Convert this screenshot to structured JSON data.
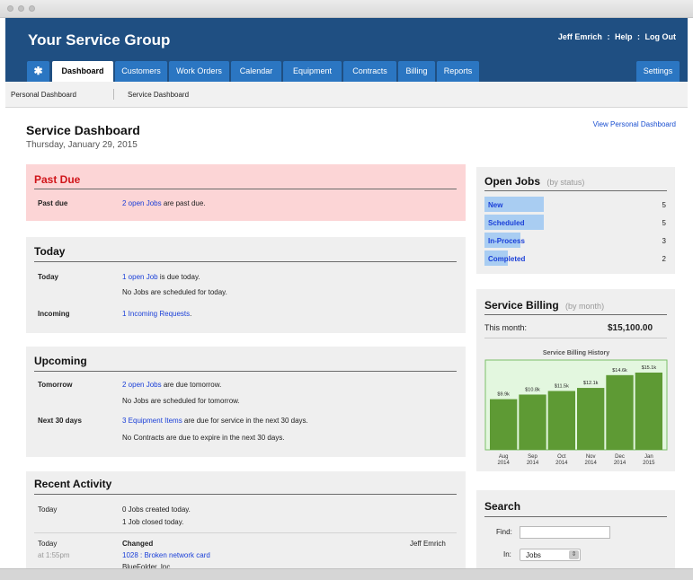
{
  "header": {
    "app_title": "Your Service Group",
    "user_name": "Jeff Emrich",
    "help": "Help",
    "logout": "Log Out",
    "separator": ":"
  },
  "nav": {
    "home_icon": "asterisk-icon",
    "tabs": [
      "Dashboard",
      "Customers",
      "Work Orders",
      "Calendar",
      "Equipment",
      "Contracts",
      "Billing",
      "Reports"
    ],
    "settings": "Settings",
    "active_tab": "Dashboard"
  },
  "subnav": [
    "Personal Dashboard",
    "Service Dashboard"
  ],
  "page": {
    "title": "Service Dashboard",
    "date": "Thursday, January 29, 2015",
    "view_personal": "View Personal Dashboard"
  },
  "past_due": {
    "title": "Past Due",
    "label": "Past due",
    "link": "2 open Jobs",
    "text": " are past due."
  },
  "today": {
    "title": "Today",
    "label_today": "Today",
    "line1_link": "1 open Job",
    "line1_text": " is due today.",
    "line2": "No Jobs are scheduled for today.",
    "label_incoming": "Incoming",
    "incoming_link": "1 Incoming Requests",
    "incoming_text": "."
  },
  "upcoming": {
    "title": "Upcoming",
    "label_tomorrow": "Tomorrow",
    "line1_link": "2 open Jobs",
    "line1_text": " are due tomorrow.",
    "line2": "No Jobs are scheduled for tomorrow.",
    "label_next30": "Next 30 days",
    "line3_link": "3 Equipment Items",
    "line3_text": " are due for service in the next 30 days.",
    "line4": "No Contracts are due to expire in the next 30 days."
  },
  "recent": {
    "title": "Recent Activity",
    "row1_label": "Today",
    "row1_line1": "0 Jobs created today.",
    "row1_line2": "1 Job closed today.",
    "row2_label": "Today",
    "row2_time": "at 1:55pm",
    "row2_action": "Changed",
    "row2_link": "1028 : Broken network card",
    "row2_company": "BlueFolder, Inc.",
    "row2_user": "Jeff Emrich"
  },
  "open_jobs": {
    "title": "Open Jobs",
    "subtitle": "(by status)",
    "statuses": [
      {
        "name": "New",
        "count": "5",
        "fraction": 1.0
      },
      {
        "name": "Scheduled",
        "count": "5",
        "fraction": 1.0
      },
      {
        "name": "In-Process",
        "count": "3",
        "fraction": 0.6
      },
      {
        "name": "Completed",
        "count": "2",
        "fraction": 0.4
      }
    ],
    "bar_color": "#a9cdf2"
  },
  "billing": {
    "title": "Service Billing",
    "subtitle": "(by month)",
    "this_month_label": "This month:",
    "this_month_value": "$15,100.00"
  },
  "chart_data": {
    "type": "bar",
    "title": "Service Billing History",
    "categories": [
      "Aug 2014",
      "Sep 2014",
      "Oct 2014",
      "Nov 2014",
      "Dec 2014",
      "Jan 2015"
    ],
    "tick_labels": [
      [
        "Aug",
        "2014"
      ],
      [
        "Sep",
        "2014"
      ],
      [
        "Oct",
        "2014"
      ],
      [
        "Nov",
        "2014"
      ],
      [
        "Dec",
        "2014"
      ],
      [
        "Jan",
        "2015"
      ]
    ],
    "values": [
      9.9,
      10.8,
      11.5,
      12.1,
      14.6,
      15.1
    ],
    "data_labels": [
      "$9.9k",
      "$10.8k",
      "$11.5k",
      "$12.1k",
      "$14.6k",
      "$15.1k"
    ],
    "ylim": [
      0,
      16.5
    ],
    "bar_color": "#5e9a34",
    "background": "#e3f7df",
    "grid": false
  },
  "search": {
    "title": "Search",
    "find_label": "Find:",
    "find_value": "",
    "in_label": "In:",
    "in_value": "Jobs"
  }
}
